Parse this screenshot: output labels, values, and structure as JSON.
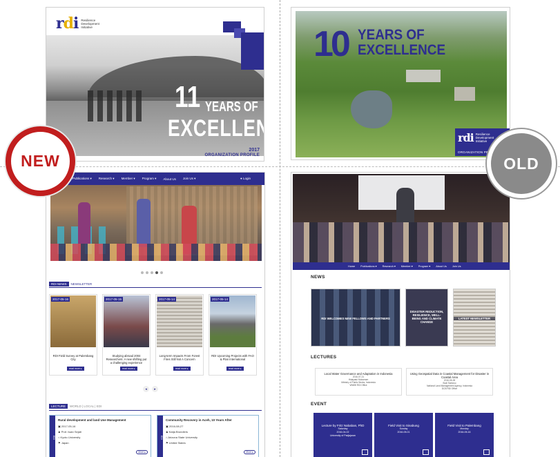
{
  "cover_new": {
    "logo": "rdi",
    "tagline": [
      "Resilience",
      "Development",
      "Initiative"
    ],
    "number": "11",
    "years_of": "YEARS OF",
    "excellence": "EXCELLENCE",
    "year": "2017",
    "profile": "ORGANIZATION PROFILE"
  },
  "cover_old": {
    "number": "10",
    "years_of": "YEARS OF",
    "excellence": "EXCELLENCE",
    "logo": "rdi",
    "tagline": [
      "Resilience",
      "Development",
      "Initiative"
    ],
    "profile": "ORGANIZATION PROFILE"
  },
  "badges": {
    "new": "NEW",
    "old": "OLD"
  },
  "site_new": {
    "nav": [
      "Publications ▾",
      "Research ▾",
      "Member ▾",
      "Program ▾",
      "About Us",
      "Join Us ▾"
    ],
    "login": "● Login",
    "news_tab": "RDI NEWS",
    "newsletter_tab": "NEWSLETTER",
    "cards": [
      {
        "date": "2017-05-16",
        "title": "RDI Field Survey at Palembang City"
      },
      {
        "date": "2017-05-15",
        "title": "Studying abroad 2004 Researchers: A new shifting put a challenging experience"
      },
      {
        "date": "2017-05-14",
        "title": "Long-term Impacts From Forest Fires Still Not A Concern"
      },
      {
        "date": "2017-05-14",
        "title": "RDI Upcoming Projects with FAO & Plan International"
      }
    ],
    "read_more": "read more ▸",
    "pager": [
      "◂",
      "▸"
    ],
    "lecture_tab": "LECTURE",
    "lecture_subtabs": "WORLD  |  LOCAL  |  EDI",
    "lectures": [
      {
        "side": "EDI",
        "title": "Rural development and land Use Management",
        "date": "2017-05-16",
        "who": "Prof. Iwan Sejati",
        "org": "Kyoto University",
        "loc": "Japan"
      },
      {
        "side": "EDI",
        "title": "Community Recovery in Aceh, 10 Years After",
        "date": "2016-08-27",
        "who": "Katja Brundiers",
        "org": "Arizona State University",
        "loc": "United States"
      }
    ],
    "more": "More ▸"
  },
  "site_old": {
    "nav": [
      "Home",
      "Publications ▾",
      "Research ▾",
      "Member ▾",
      "Program ▾",
      "About Us",
      "Join Us"
    ],
    "news_heading": "NEWS",
    "news": [
      "RDI WELCOMES NEW FELLOWS AND PARTNERS",
      "DISASTER REDUCTION, RESILIENCE, WELL-BEING AND CLIMATE CHANGE",
      "LATEST NEWSLETTER"
    ],
    "lectures_heading": "LECTURES",
    "lectures": [
      {
        "title": "Local Water Governance and Adaptation in Indonesia",
        "date": "2016-07-21",
        "who": "Hidayatul Mukarram",
        "org": "Ministry of Public Works, Indonesia",
        "office": "WWMI RDI Office"
      },
      {
        "title": "Using Geospatial Data in Coastal Management for Disaster in Coastal Area",
        "date": "2016-05-28",
        "who": "Budi Santoso",
        "org": "National Land Management Agency, Indonesia",
        "office": "DCB RDI Office"
      }
    ],
    "event_heading": "EVENT",
    "events": [
      {
        "title": "Lecture by Fritz Nababan, PhD",
        "day": "Saturday",
        "date": "2016-04-02",
        "place": "University of Padjajaran"
      },
      {
        "title": "Field Visit to Sinabung",
        "day": "Sunday",
        "date": "2016-05-01",
        "place": ""
      },
      {
        "title": "Field Visit to Palembang",
        "day": "Monday",
        "date": "2016-05-16",
        "place": ""
      }
    ]
  }
}
